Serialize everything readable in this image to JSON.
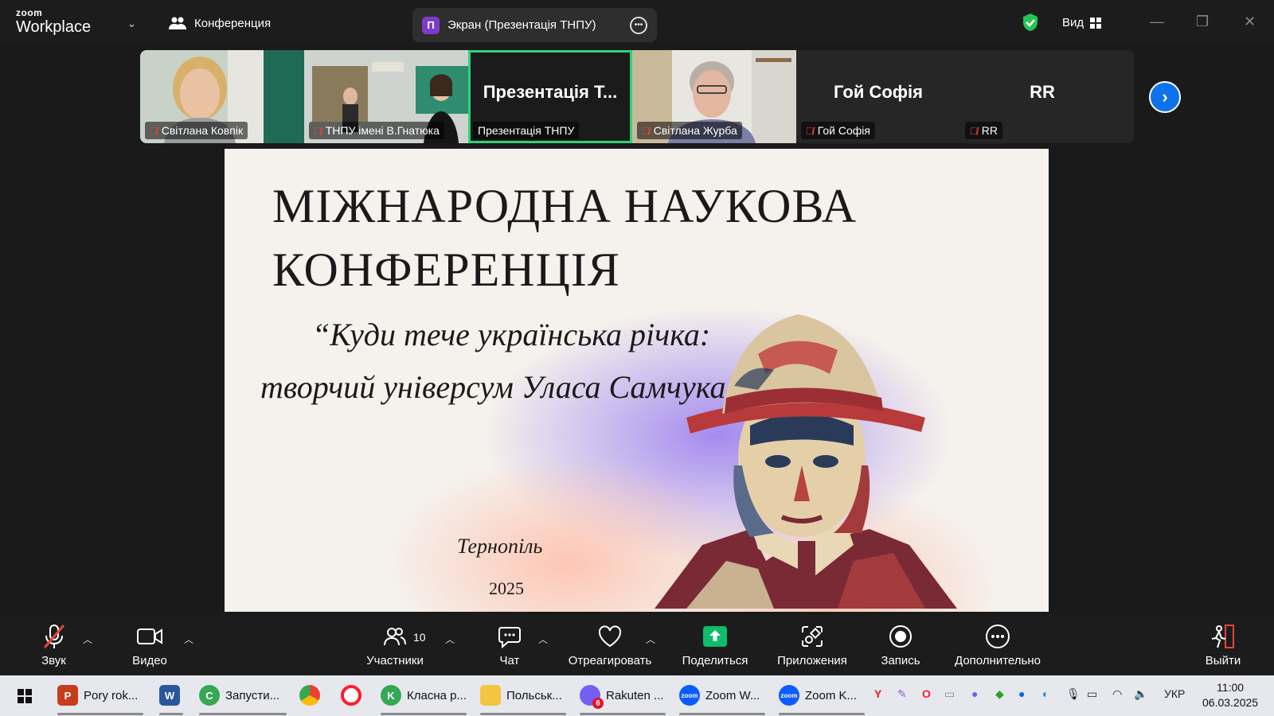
{
  "app": {
    "logo_line1": "zoom",
    "logo_line2": "Workplace"
  },
  "topbar": {
    "meeting_title": "Конференция",
    "share_badge": "П",
    "share_title": "Экран (Презентація ТНПУ)",
    "view_label": "Вид"
  },
  "participants": [
    {
      "name": "Світлана Ковпік",
      "muted": true
    },
    {
      "name": "ТНПУ імені В.Гнатюка",
      "muted": true
    },
    {
      "name": "Презентація ТНПУ",
      "big": "Презентація Т...",
      "muted": false
    },
    {
      "name": "Світлана Журба",
      "muted": true
    },
    {
      "name": "Гой Софія",
      "big": "Гой Софія",
      "muted": true
    },
    {
      "name": "RR",
      "big": "RR",
      "muted": true
    }
  ],
  "slide": {
    "title_line1": "МІЖНАРОДНА НАУКОВА",
    "title_line2": "КОНФЕРЕНЦІЯ",
    "subtitle_line1": "“Куди тече українська річка:",
    "subtitle_line2": "творчий універсум Уласа Самчука”",
    "city": "Тернопіль",
    "year": "2025"
  },
  "toolbar": {
    "audio": "Звук",
    "video": "Видео",
    "participants": "Участники",
    "participants_count": "10",
    "chat": "Чат",
    "react": "Отреагировать",
    "share": "Поделиться",
    "apps": "Приложения",
    "record": "Запись",
    "more": "Дополнительно",
    "leave": "Выйти"
  },
  "taskbar": {
    "apps": [
      {
        "label": "Pory rok...",
        "icon": "powerpoint-icon",
        "color": "#c43e1c",
        "glyph": "P"
      },
      {
        "label": "",
        "icon": "word-icon",
        "color": "#2b579a",
        "glyph": "W"
      },
      {
        "label": "Запусти...",
        "icon": "chrome-icon",
        "color": "#34a853",
        "glyph": "C"
      },
      {
        "label": "",
        "icon": "chrome-icon",
        "color": "#ea4335",
        "glyph": ""
      },
      {
        "label": "",
        "icon": "opera-icon",
        "color": "#ff1b2d",
        "glyph": "O"
      },
      {
        "label": "Класна р...",
        "icon": "chrome-icon",
        "color": "#34a853",
        "glyph": "K"
      },
      {
        "label": "Польськ...",
        "icon": "folder-icon",
        "color": "#f4c542",
        "glyph": ""
      },
      {
        "label": "Rakuten ...",
        "icon": "viber-icon",
        "color": "#7360f2",
        "glyph": "6"
      },
      {
        "label": "Zoom W...",
        "icon": "zoom-icon",
        "color": "#0b5cff",
        "glyph": "zoom"
      },
      {
        "label": "Zoom K...",
        "icon": "zoom-icon",
        "color": "#0b5cff",
        "glyph": "zoom"
      }
    ],
    "language": "УКР",
    "time": "11:00",
    "date": "06.03.2025"
  },
  "colors": {
    "active_speaker": "#2bd47a",
    "accent": "#0e72ed",
    "share_green": "#0dbd6a",
    "mic_off": "#e8423a"
  }
}
